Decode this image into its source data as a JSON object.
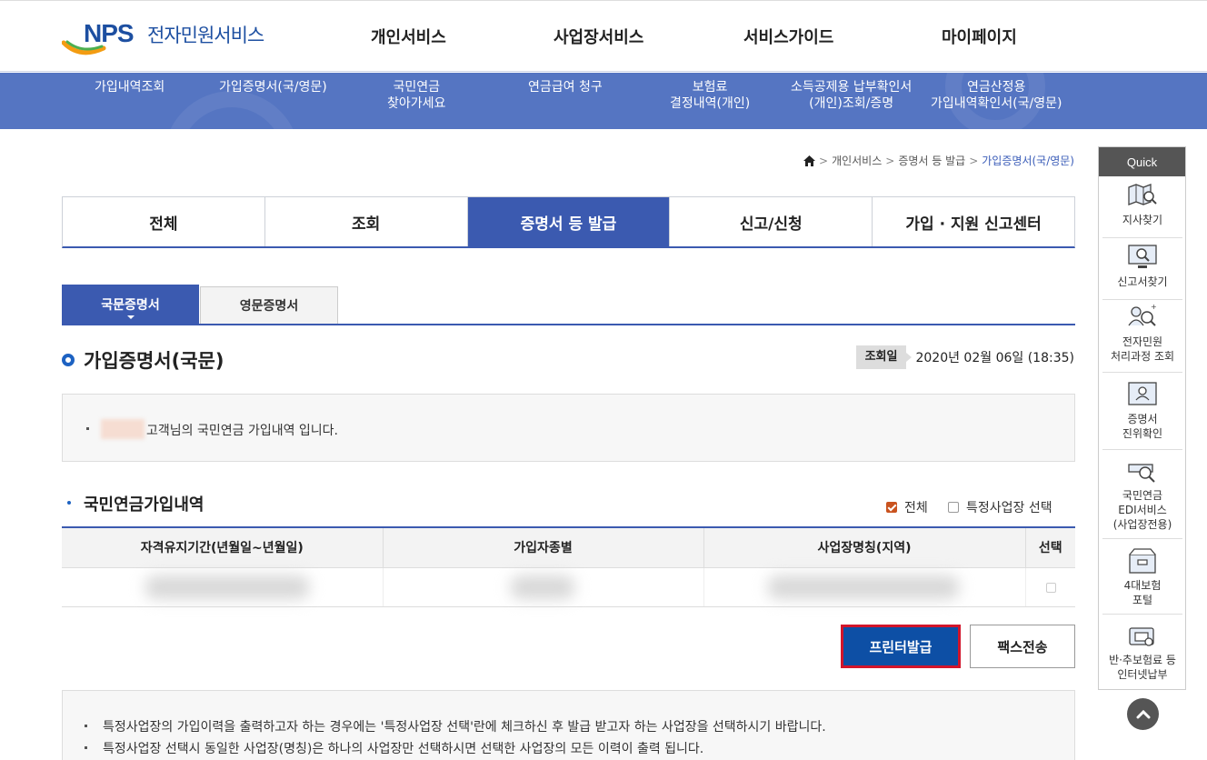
{
  "header": {
    "logo_nps": "NPS",
    "logo_text": "전자민원서비스",
    "nav": [
      "개인서비스",
      "사업장서비스",
      "서비스가이드",
      "마이페이지"
    ]
  },
  "subnav": [
    {
      "line1": "가입내역조회",
      "line2": ""
    },
    {
      "line1": "가입증명서(국/영문)",
      "line2": ""
    },
    {
      "line1": "국민연금",
      "line2": "찾아가세요"
    },
    {
      "line1": "연금급여 청구",
      "line2": ""
    },
    {
      "line1": "보험료",
      "line2": "결정내역(개인)"
    },
    {
      "line1": "소득공제용 납부확인서",
      "line2": "(개인)조회/증명"
    },
    {
      "line1": "연금산정용",
      "line2": "가입내역확인서(국/영문)"
    }
  ],
  "breadcrumb": {
    "items": [
      "개인서비스",
      "증명서 등 발급"
    ],
    "current": "가입증명서(국/영문)"
  },
  "main_tabs": [
    "전체",
    "조회",
    "증명서 등 발급",
    "신고/신청",
    "가입 · 지원 신고센터"
  ],
  "sub_tabs": {
    "active": "국문증명서",
    "other": "영문증명서"
  },
  "page_title": "가입증명서(국문)",
  "lookup": {
    "label": "조회일",
    "value": "2020년 02월 06일 (18:35)"
  },
  "info_message": "고객님의 국민연금 가입내역 입니다.",
  "section": {
    "title": "국민연금가입내역",
    "check_all_label": "전체",
    "check_specific_label": "특정사업장 선택"
  },
  "table": {
    "headers": [
      "자격유지기간(년월일~년월일)",
      "가입자종별",
      "사업장명칭(지역)",
      "선택"
    ]
  },
  "buttons": {
    "print": "프린터발급",
    "fax": "팩스전송"
  },
  "notes": [
    "특정사업장의 가입이력을 출력하고자 하는 경우에는 '특정사업장 선택'란에 체크하신 후 발급 받고자 하는 사업장을 선택하시기 바랍니다.",
    "특정사업장 선택시 동일한 사업장(명칭)은 하나의 사업장만 선택하시면 선택한 사업장의 모든 이력이 출력 됩니다."
  ],
  "quick": {
    "head": "Quick",
    "items": [
      {
        "icon": "map-search-icon",
        "line1": "지사찾기",
        "line2": ""
      },
      {
        "icon": "monitor-search-icon",
        "line1": "신고서찾기",
        "line2": ""
      },
      {
        "icon": "people-search-icon",
        "line1": "전자민원",
        "line2": "처리과정 조회"
      },
      {
        "icon": "id-card-icon",
        "line1": "증명서",
        "line2": "진위확인"
      },
      {
        "icon": "edi-search-icon",
        "line1": "국민연금",
        "line2": "EDI서비스",
        "line3": "(사업장전용)"
      },
      {
        "icon": "box-icon",
        "line1": "4대보험",
        "line2": "포털"
      },
      {
        "icon": "card-payment-icon",
        "line1": "반·추보험료 등",
        "line2": "인터넷납부"
      }
    ]
  },
  "colors": {
    "primary": "#3b5ab0",
    "band": "#5575c2",
    "print_border": "#d2152b",
    "check": "#c9531f"
  }
}
